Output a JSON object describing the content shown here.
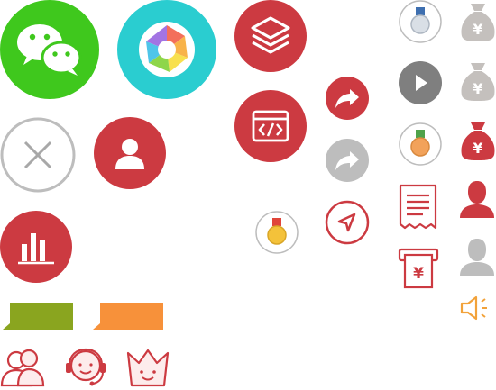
{
  "sheet": {
    "colors": {
      "wechat_green": "#3fc81d",
      "camera_teal": "#2acdd0",
      "brand_red": "#cc3a41",
      "gray": "#bdbdbd",
      "dark_gray": "#7f7f7f",
      "olive": "#8aa51f",
      "orange": "#f7913a",
      "gold": "#f4c23a",
      "bronze": "#f2a25a"
    },
    "icons": [
      {
        "name": "wechat-icon"
      },
      {
        "name": "camera-aperture-icon"
      },
      {
        "name": "layers-icon"
      },
      {
        "name": "medal-gray-icon"
      },
      {
        "name": "money-bag-gray-icon",
        "glyph": "¥"
      },
      {
        "name": "play-icon"
      },
      {
        "name": "money-bag-gray-2-icon",
        "glyph": "¥"
      },
      {
        "name": "close-icon"
      },
      {
        "name": "user-icon"
      },
      {
        "name": "code-window-icon"
      },
      {
        "name": "share-red-icon"
      },
      {
        "name": "share-gray-icon"
      },
      {
        "name": "medal-bronze-icon"
      },
      {
        "name": "money-bag-red-icon",
        "glyph": "¥"
      },
      {
        "name": "chart-icon"
      },
      {
        "name": "medal-gold-icon"
      },
      {
        "name": "navigation-icon"
      },
      {
        "name": "receipt-icon"
      },
      {
        "name": "person-red-icon"
      },
      {
        "name": "withdraw-icon",
        "glyph": "¥"
      },
      {
        "name": "person-gray-icon"
      },
      {
        "name": "speech-bubble-green-icon"
      },
      {
        "name": "speech-bubble-orange-icon"
      },
      {
        "name": "speaker-icon"
      },
      {
        "name": "contacts-icon"
      },
      {
        "name": "customer-service-icon"
      },
      {
        "name": "crown-icon"
      }
    ]
  }
}
